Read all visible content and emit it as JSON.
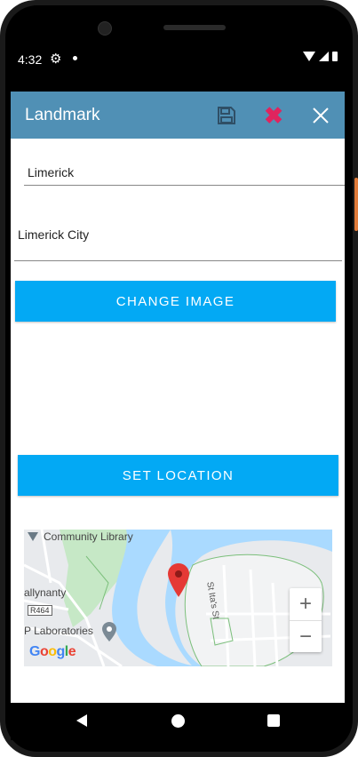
{
  "status_bar": {
    "time": "4:32",
    "icons": [
      "gear-icon",
      "notification-dot",
      "wifi-icon",
      "signal-icon",
      "battery-icon"
    ]
  },
  "app_bar": {
    "title": "Landmark",
    "actions": [
      {
        "name": "save",
        "icon": "floppy-disk-icon"
      },
      {
        "name": "delete",
        "icon": "red-x-icon",
        "color": "#e0245e"
      },
      {
        "name": "close",
        "icon": "close-icon"
      }
    ],
    "background": "#5090b5"
  },
  "form": {
    "title_value": "Limerick",
    "description_value": "Limerick City"
  },
  "buttons": {
    "change_image": "CHANGE IMAGE",
    "set_location": "SET LOCATION",
    "color": "#03a9f4"
  },
  "map": {
    "labels": {
      "community": "Community Library",
      "ballynanty": "allynanty",
      "labs": "P Laboratories",
      "road": "R464",
      "street": "St Ita's St"
    },
    "logo": "Google",
    "zoom_in": "+",
    "zoom_out": "−"
  },
  "nav_bar": {
    "icons": [
      "back-icon",
      "home-icon",
      "recents-icon"
    ]
  }
}
